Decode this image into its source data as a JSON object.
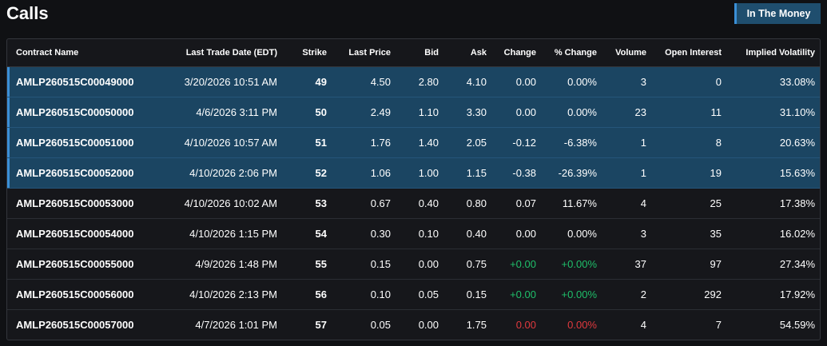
{
  "header": {
    "title": "Calls",
    "itm_button": "In The Money"
  },
  "columns": [
    "Contract Name",
    "Last Trade Date (EDT)",
    "Strike",
    "Last Price",
    "Bid",
    "Ask",
    "Change",
    "% Change",
    "Volume",
    "Open Interest",
    "Implied Volatility"
  ],
  "rows": [
    {
      "itm": true,
      "contract": "AMLP260515C00049000",
      "date": "3/20/2026 10:51 AM",
      "strike": "49",
      "last": "4.50",
      "bid": "2.80",
      "ask": "4.10",
      "change": "0.00",
      "pct": "0.00%",
      "dir": "flat",
      "volume": "3",
      "oi": "0",
      "iv": "33.08%"
    },
    {
      "itm": true,
      "contract": "AMLP260515C00050000",
      "date": "4/6/2026 3:11 PM",
      "strike": "50",
      "last": "2.49",
      "bid": "1.10",
      "ask": "3.30",
      "change": "0.00",
      "pct": "0.00%",
      "dir": "flat",
      "volume": "23",
      "oi": "11",
      "iv": "31.10%"
    },
    {
      "itm": true,
      "contract": "AMLP260515C00051000",
      "date": "4/10/2026 10:57 AM",
      "strike": "51",
      "last": "1.76",
      "bid": "1.40",
      "ask": "2.05",
      "change": "-0.12",
      "pct": "-6.38%",
      "dir": "flat",
      "volume": "1",
      "oi": "8",
      "iv": "20.63%"
    },
    {
      "itm": true,
      "contract": "AMLP260515C00052000",
      "date": "4/10/2026 2:06 PM",
      "strike": "52",
      "last": "1.06",
      "bid": "1.00",
      "ask": "1.15",
      "change": "-0.38",
      "pct": "-26.39%",
      "dir": "flat",
      "volume": "1",
      "oi": "19",
      "iv": "15.63%"
    },
    {
      "itm": false,
      "contract": "AMLP260515C00053000",
      "date": "4/10/2026 10:02 AM",
      "strike": "53",
      "last": "0.67",
      "bid": "0.40",
      "ask": "0.80",
      "change": "0.07",
      "pct": "11.67%",
      "dir": "flat",
      "volume": "4",
      "oi": "25",
      "iv": "17.38%"
    },
    {
      "itm": false,
      "contract": "AMLP260515C00054000",
      "date": "4/10/2026 1:15 PM",
      "strike": "54",
      "last": "0.30",
      "bid": "0.10",
      "ask": "0.40",
      "change": "0.00",
      "pct": "0.00%",
      "dir": "flat",
      "volume": "3",
      "oi": "35",
      "iv": "16.02%"
    },
    {
      "itm": false,
      "contract": "AMLP260515C00055000",
      "date": "4/9/2026 1:48 PM",
      "strike": "55",
      "last": "0.15",
      "bid": "0.00",
      "ask": "0.75",
      "change": "+0.00",
      "pct": "+0.00%",
      "dir": "pos",
      "volume": "37",
      "oi": "97",
      "iv": "27.34%"
    },
    {
      "itm": false,
      "contract": "AMLP260515C00056000",
      "date": "4/10/2026 2:13 PM",
      "strike": "56",
      "last": "0.10",
      "bid": "0.05",
      "ask": "0.15",
      "change": "+0.00",
      "pct": "+0.00%",
      "dir": "pos",
      "volume": "2",
      "oi": "292",
      "iv": "17.92%"
    },
    {
      "itm": false,
      "contract": "AMLP260515C00057000",
      "date": "4/7/2026 1:01 PM",
      "strike": "57",
      "last": "0.05",
      "bid": "0.00",
      "ask": "1.75",
      "change": "0.00",
      "pct": "0.00%",
      "dir": "neg",
      "volume": "4",
      "oi": "7",
      "iv": "54.59%"
    }
  ],
  "colors": {
    "itm_row": "#1b4562",
    "accent": "#3a8fd6",
    "positive": "#1fbf6a",
    "negative": "#e0393e",
    "background": "#101114"
  }
}
